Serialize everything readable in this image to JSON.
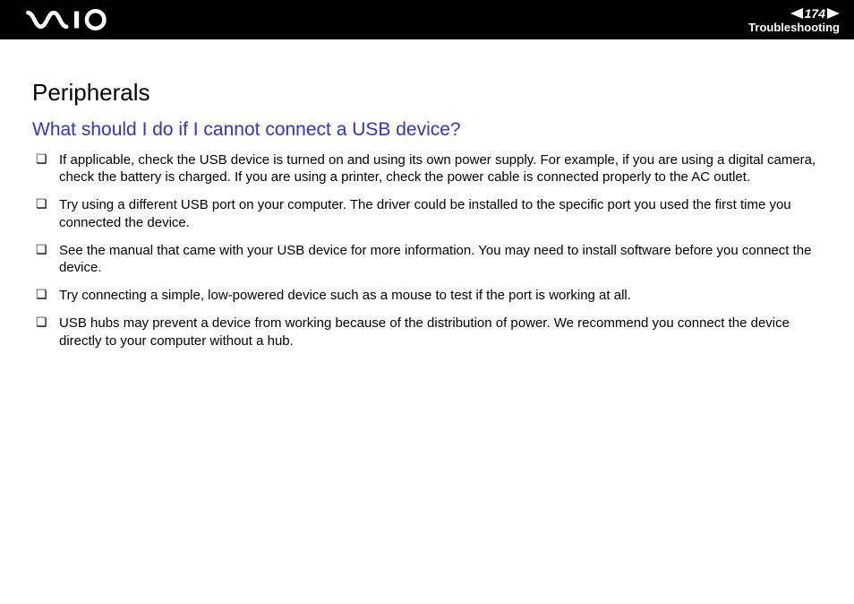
{
  "header": {
    "logo_name": "vaio-logo",
    "page_number": "174",
    "section": "Troubleshooting"
  },
  "content": {
    "title": "Peripherals",
    "question": "What should I do if I cannot connect a USB device?",
    "bullets": [
      "If applicable, check the USB device is turned on and using its own power supply. For example, if you are using a digital camera, check the battery is charged. If you are using a printer, check the power cable is connected properly to the AC outlet.",
      "Try using a different USB port on your computer. The driver could be installed to the specific port you used the first time you connected the device.",
      "See the manual that came with your USB device for more information. You may need to install software before you connect the device.",
      "Try connecting a simple, low-powered device such as a mouse to test if the port is working at all.",
      "USB hubs may prevent a device from working because of the distribution of power. We recommend you connect the device directly to your computer without a hub."
    ]
  }
}
